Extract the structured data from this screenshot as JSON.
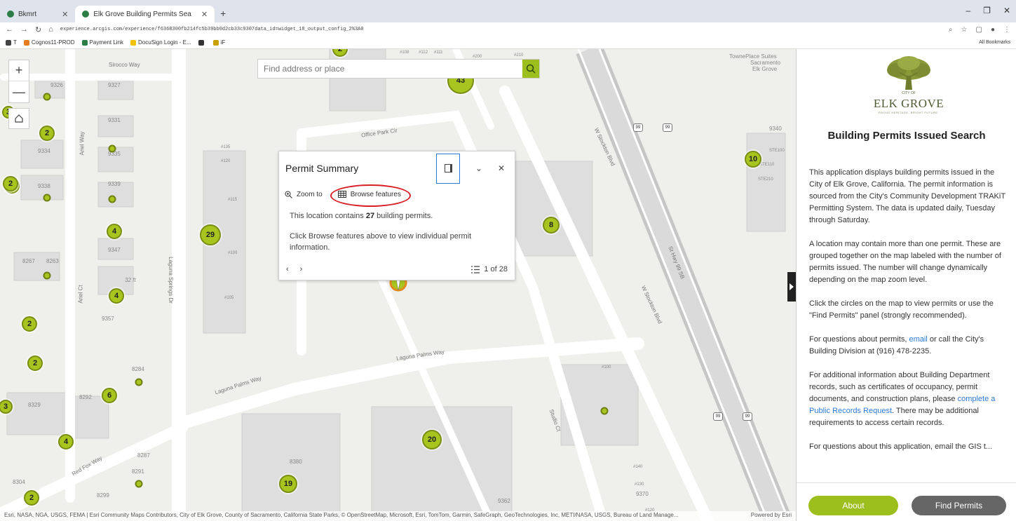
{
  "browser": {
    "tabs": [
      {
        "label": "Bkmrt"
      },
      {
        "label": "Elk Grove Building Permits Sea"
      }
    ],
    "new_tab": "+",
    "window_controls": [
      "–",
      "❐",
      "✕"
    ],
    "url": "experience.arcgis.com/experience/f6368300fb214fc5b39bb0d2cb33c9307data_id=widget_18_output_config_2%3A0",
    "bookmarks": [
      {
        "label": "T",
        "color": "#444444"
      },
      {
        "label": "Cognos11-PROD",
        "color": "#e57c20"
      },
      {
        "label": "Payment Link",
        "color": "#2d7d46"
      },
      {
        "label": "DocuSign Login - E...",
        "color": "#f2c200"
      },
      {
        "label": "",
        "color": "#333333"
      },
      {
        "label": "iF",
        "color": "#c8a000"
      }
    ],
    "all_bookmarks": "All Bookmarks"
  },
  "map": {
    "search": {
      "placeholder": "Find address or place"
    },
    "zoom_in": "+",
    "zoom_out": "—",
    "labels": [
      {
        "text": "Sirocco Way",
        "kind": "street"
      },
      {
        "text": "Office Park Cir",
        "kind": "street"
      },
      {
        "text": "Laguna Palms Way",
        "kind": "street"
      },
      {
        "text": "Laguna Springs Dr",
        "kind": "street"
      },
      {
        "text": "Ariel Way",
        "kind": "street"
      },
      {
        "text": "Ariel Ct",
        "kind": "street"
      },
      {
        "text": "W Stockton Blvd",
        "kind": "street"
      },
      {
        "text": "St Hwy 99 SB",
        "kind": "street"
      },
      {
        "text": "Studio Ct",
        "kind": "street"
      },
      {
        "text": "Red Fox Way",
        "kind": "street"
      },
      {
        "text": "TownePlace Suites",
        "kind": "poi"
      },
      {
        "text": "Sacramento",
        "kind": "poi"
      },
      {
        "text": "Elk Grove",
        "kind": "poi"
      },
      {
        "text": "9326"
      },
      {
        "text": "9327"
      },
      {
        "text": "9331"
      },
      {
        "text": "9334"
      },
      {
        "text": "9335"
      },
      {
        "text": "9338"
      },
      {
        "text": "9339"
      },
      {
        "text": "9347"
      },
      {
        "text": "8267"
      },
      {
        "text": "8263"
      },
      {
        "text": "9357"
      },
      {
        "text": "8284"
      },
      {
        "text": "8292"
      },
      {
        "text": "8329"
      },
      {
        "text": "8287"
      },
      {
        "text": "8291"
      },
      {
        "text": "8304"
      },
      {
        "text": "8299"
      },
      {
        "text": "8380"
      },
      {
        "text": "9362"
      },
      {
        "text": "9340"
      },
      {
        "text": "9370"
      },
      {
        "text": "32 ft"
      },
      {
        "text": "#135"
      },
      {
        "text": "#120"
      },
      {
        "text": "#115"
      },
      {
        "text": "#100"
      },
      {
        "text": "#105"
      },
      {
        "text": "#108"
      },
      {
        "text": "#112"
      },
      {
        "text": "#111"
      },
      {
        "text": "#200"
      },
      {
        "text": "#210"
      },
      {
        "text": "STE100"
      },
      {
        "text": "STE110"
      },
      {
        "text": "STE210"
      },
      {
        "text": "#140"
      },
      {
        "text": "#130"
      },
      {
        "text": "#120"
      },
      {
        "text": "#100"
      }
    ],
    "clusters": [
      "43",
      "2",
      "2",
      "4",
      "4",
      "29",
      "8",
      "10",
      "2",
      "2",
      "6",
      "4",
      "20",
      "19",
      "2",
      "2",
      "3",
      "3",
      "2"
    ],
    "highway_shields": [
      "99",
      "99",
      "99",
      "99"
    ],
    "attribution": "Esri, NASA, NGA, USGS, FEMA | Esri Community Maps Contributors, City of Elk Grove, County of Sacramento, California State Parks, © OpenStreetMap, Microsoft, Esri, TomTom, Garmin, SafeGraph, GeoTechnologies, Inc, METI/NASA, USGS, Bureau of Land Manage...",
    "powered_by": "Powered by Esri"
  },
  "popup": {
    "title": "Permit Summary",
    "zoom_to": "Zoom to",
    "browse_features": "Browse features",
    "line1_pre": "This location contains",
    "line1_count": "27",
    "line1_post": "building permits.",
    "line2": "Click Browse features above to view individual permit information.",
    "prev": "‹",
    "next": "›",
    "page_label": "1 of 28"
  },
  "side": {
    "logo_city": "CITY OF",
    "logo_text": "ELK GROVE",
    "logo_tagline": "PROUD HERITAGE. BRIGHT FUTURE.",
    "title": "Building Permits Issued Search",
    "p1": "This application displays building permits issued in the City of Elk Grove, California. The permit information is sourced from the City's Community Development TRAKiT Permitting System. The data is updated daily, Tuesday through Saturday.",
    "p2": "A location may contain more than one permit. These are grouped together on the map labeled with the number of permits issued. The number will change dynamically depending on the map zoom level.",
    "p3": "Click the circles on the map to view permits or use the \"Find Permits\" panel (strongly recommended).",
    "p4_pre": "For questions about permits,",
    "p4_link": "email",
    "p4_post": "or call the City's Building Division at (916) 478-2235.",
    "p5_pre": "For additional information about Building Department records, such as certificates of occupancy, permit documents, and construction plans, please",
    "p5_link": "complete a Public Records Request",
    "p5_post": ". There may be additional requirements to access certain records.",
    "p6": "For questions about this application, email the GIS t...",
    "about_label": "About",
    "find_label": "Find Permits"
  },
  "colors": {
    "accent_green": "#9dbf1e",
    "link_blue": "#2d7ad6",
    "highlight_red": "#d81f26",
    "find_button": "#666666"
  }
}
